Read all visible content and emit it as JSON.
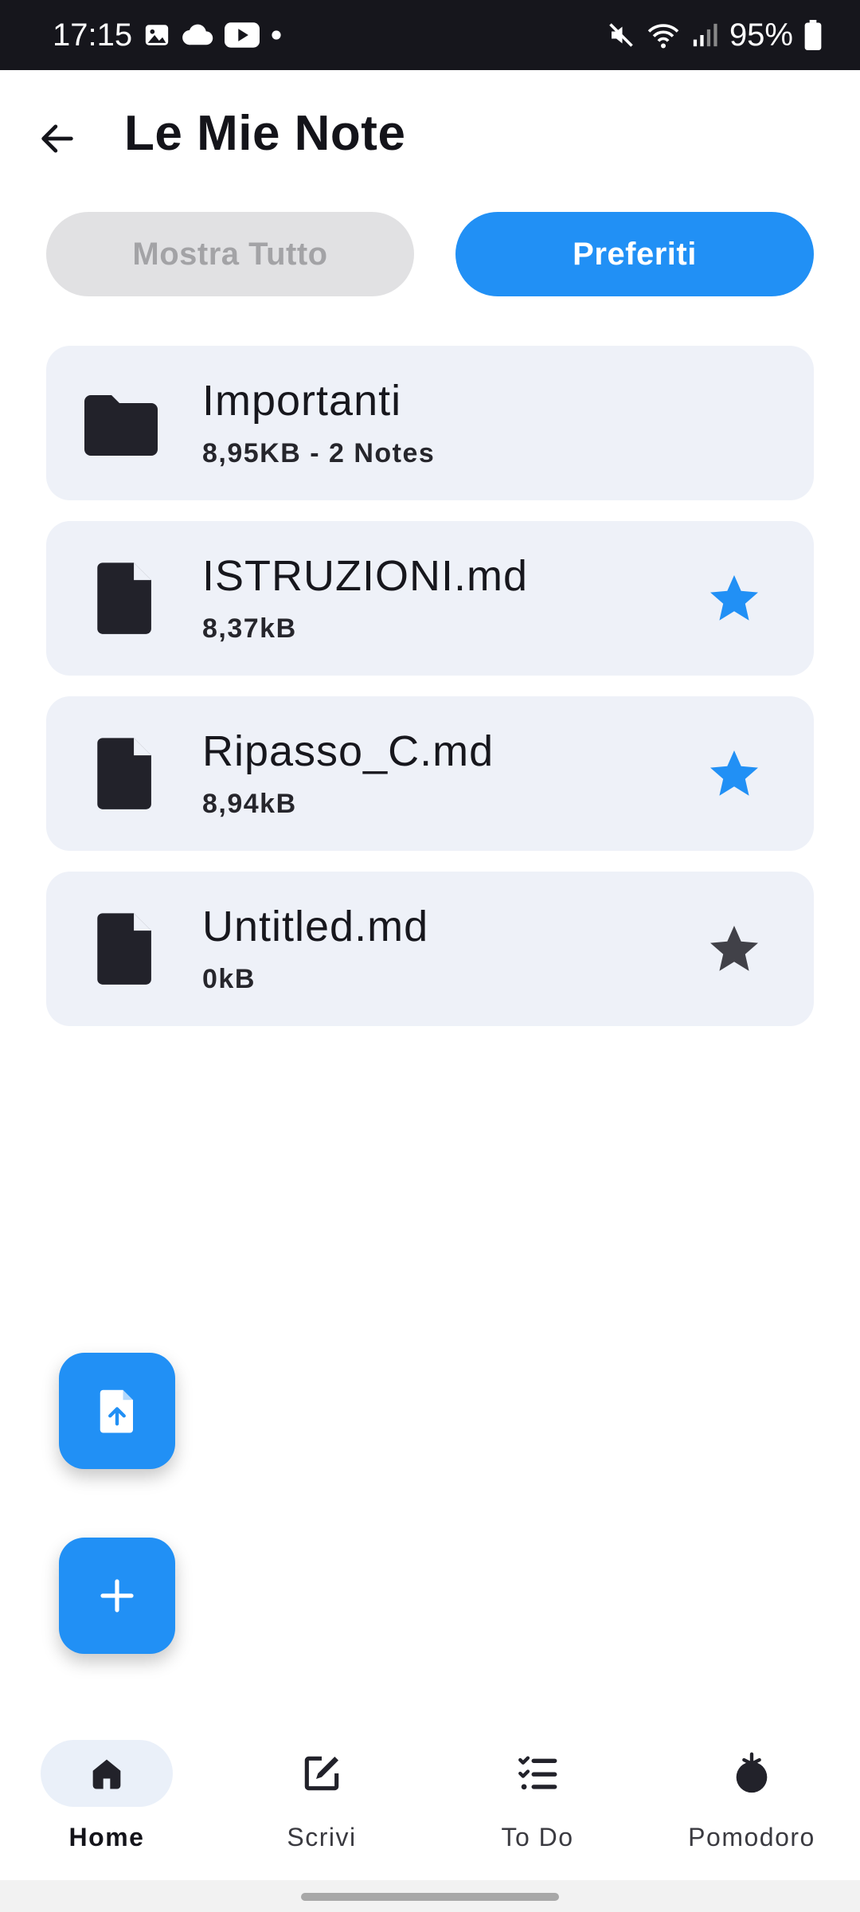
{
  "status_bar": {
    "time": "17:15",
    "battery": "95%",
    "left_icons": [
      "gallery-icon",
      "cloud-icon",
      "youtube-icon",
      "dot-icon"
    ],
    "right_icons": [
      "mute-icon",
      "wifi-icon",
      "signal-icon",
      "battery-icon"
    ]
  },
  "header": {
    "title": "Le Mie Note",
    "back_icon": "arrow-back-icon"
  },
  "filters": {
    "all_label": "Mostra Tutto",
    "favorites_label": "Preferiti",
    "selected": "Preferiti"
  },
  "items": [
    {
      "type": "folder",
      "icon": "folder-icon",
      "title": "Importanti",
      "subtitle": "8,95KB - 2 Notes"
    },
    {
      "type": "file",
      "icon": "file-icon",
      "title": "ISTRUZIONI.md",
      "subtitle": "8,37kB",
      "favorite": true
    },
    {
      "type": "file",
      "icon": "file-icon",
      "title": "Ripasso_C.md",
      "subtitle": "8,94kB",
      "favorite": true
    },
    {
      "type": "file",
      "icon": "file-icon",
      "title": "Untitled.md",
      "subtitle": "0kB",
      "favorite": false
    }
  ],
  "fabs": [
    {
      "icon": "file-upload-icon"
    },
    {
      "icon": "plus-icon"
    }
  ],
  "nav": [
    {
      "label": "Home",
      "icon": "home-icon",
      "active": true
    },
    {
      "label": "Scrivi",
      "icon": "edit-icon",
      "active": false
    },
    {
      "label": "To Do",
      "icon": "checklist-icon",
      "active": false
    },
    {
      "label": "Pomodoro",
      "icon": "tomato-icon",
      "active": false
    }
  ],
  "colors": {
    "accent": "#2190f5",
    "card_bg": "#eef1f8",
    "star_off": "#414148",
    "status_bar": "#16161c"
  }
}
